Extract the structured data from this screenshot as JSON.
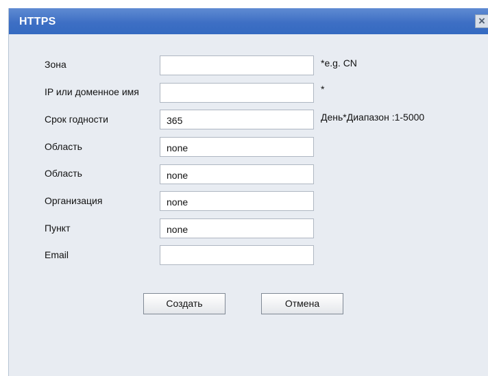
{
  "dialog": {
    "title": "HTTPS",
    "close_label": "×"
  },
  "form": {
    "fields": [
      {
        "label": "Зона",
        "value": "",
        "hint": "*e.g. CN"
      },
      {
        "label": "IP или доменное имя",
        "value": "",
        "hint": "*"
      },
      {
        "label": "Срок годности",
        "value": "365",
        "hint": "День*Диапазон :1-5000"
      },
      {
        "label": "Область",
        "value": "none",
        "hint": ""
      },
      {
        "label": "Область",
        "value": "none",
        "hint": ""
      },
      {
        "label": "Организация",
        "value": "none",
        "hint": ""
      },
      {
        "label": "Пункт",
        "value": "none",
        "hint": ""
      },
      {
        "label": "Email",
        "value": "",
        "hint": ""
      }
    ]
  },
  "buttons": {
    "create_label": "Создать",
    "cancel_label": "Отмена"
  }
}
